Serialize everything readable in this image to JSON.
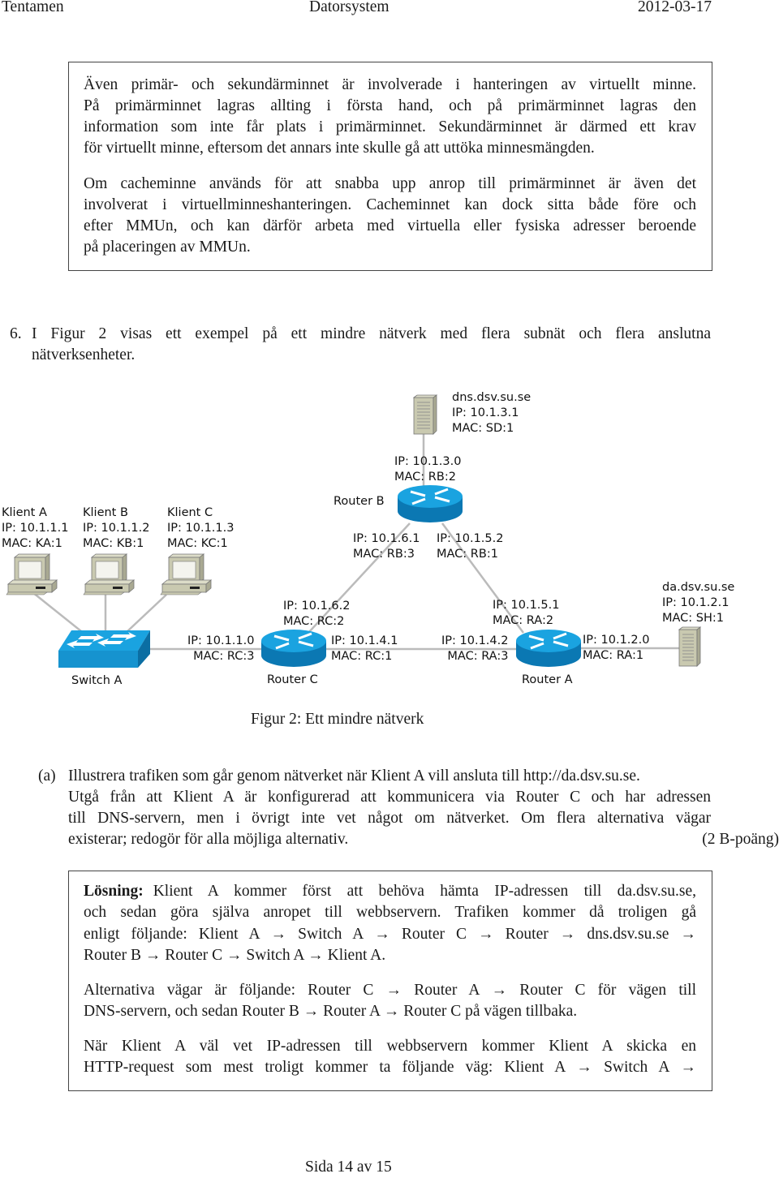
{
  "header": {
    "left": "Tentamen",
    "center": "Datorsystem",
    "right": "2012-03-17"
  },
  "box1": {
    "para1": [
      "Även primär- och sekundärminnet är involverade i hanteringen av virtuellt minne.",
      "På primärminnet lagras allting i första hand, och på primärminnet lagras den",
      "information som inte får plats i primärminnet. Sekundärminnet är därmed ett krav",
      "för virtuellt minne, eftersom det annars inte skulle gå att uttöka minnesmängden."
    ],
    "para2": [
      "Om cacheminne används för att snabba upp anrop till primärminnet är även det",
      "involverat i virtuellminneshanteringen. Cacheminnet kan dock sitta både före och",
      "efter MMUn, och kan därför arbeta med virtuella eller fysiska adresser beroende",
      "på placeringen av MMUn."
    ]
  },
  "question": {
    "number": "6.",
    "lines": [
      "I Figur 2 visas ett exempel på ett mindre nätverk med flera subnät och flera anslutna",
      "nätverksenheter."
    ]
  },
  "figure": {
    "caption": "Figur 2: Ett mindre nätverk",
    "dns": [
      "dns.dsv.su.se",
      "IP: 10.1.3.1",
      "MAC: SD:1"
    ],
    "rb_top": [
      "IP: 10.1.3.0",
      "MAC: RB:2"
    ],
    "router_b": "Router B",
    "rb_left": [
      "IP: 10.1.6.1",
      "MAC: RB:3"
    ],
    "rb_right": [
      "IP: 10.1.5.2",
      "MAC: RB:1"
    ],
    "klient_a": [
      "Klient A",
      "IP: 10.1.1.1",
      "MAC: KA:1"
    ],
    "klient_b": [
      "Klient B",
      "IP: 10.1.1.2",
      "MAC: KB:1"
    ],
    "klient_c": [
      "Klient C",
      "IP: 10.1.1.3",
      "MAC: KC:1"
    ],
    "rc_top": [
      "IP: 10.1.6.2",
      "MAC: RC:2"
    ],
    "rc_left": [
      "IP: 10.1.1.0",
      "MAC: RC:3"
    ],
    "rc_right": [
      "IP: 10.1.4.1",
      "MAC: RC:1"
    ],
    "ra_top": [
      "IP: 10.1.5.1",
      "MAC: RA:2"
    ],
    "ra_left": [
      "IP: 10.1.4.2",
      "MAC: RA:3"
    ],
    "ra_right": [
      "IP: 10.1.2.0",
      "MAC: RA:1"
    ],
    "da": [
      "da.dsv.su.se",
      "IP: 10.1.2.1",
      "MAC: SH:1"
    ],
    "switch_a": "Switch A",
    "router_c": "Router C",
    "router_a": "Router A",
    "colors": {
      "device_blue": "#1aa3e0",
      "device_dark": "#0b6ea3",
      "computer": "#c9c9b0",
      "link": "#bbbbbb"
    }
  },
  "part_a": {
    "label": "(a)",
    "lines": [
      "Illustrera trafiken som går genom nätverket när Klient A vill ansluta till http://da.dsv.su.se.",
      "Utgå från att Klient A är konfigurerad att kommunicera via Router C och har adressen",
      "till DNS-servern, men i övrigt inte vet något om nätverket. Om flera alternativa vägar",
      "existerar; redogör för alla möjliga alternativ."
    ],
    "points": "(2 B-poäng)"
  },
  "solution": {
    "label": "Lösning:",
    "para1": [
      "Klient A kommer först att behöva hämta IP-adressen till da.dsv.su.se,",
      "och sedan göra själva anropet till webbservern. Trafiken kommer då troligen gå",
      "enligt följande: Klient A → Switch A → Router C → Router → dns.dsv.su.se →",
      "Router B → Router C → Switch A → Klient A."
    ],
    "para2": [
      "Alternativa vägar är följande: Router C → Router A → Router C för vägen till",
      "DNS-servern, och sedan Router B → Router A → Router C på vägen tillbaka."
    ],
    "para3": [
      "När Klient A väl vet IP-adressen till webbservern kommer Klient A skicka en",
      "HTTP-request som mest troligt kommer ta följande väg: Klient A → Switch A →"
    ]
  },
  "footer": {
    "page": "Sida 14 av 15"
  }
}
